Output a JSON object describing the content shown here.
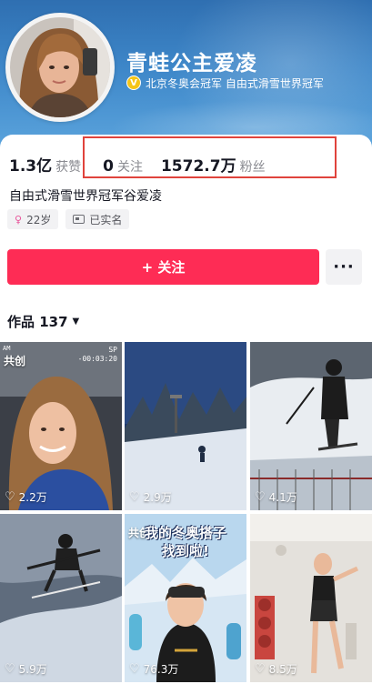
{
  "profile": {
    "name": "青蛙公主爱凌",
    "verification": "北京冬奥会冠军 自由式滑雪世界冠军",
    "bio": "自由式滑雪世界冠军谷爱凌"
  },
  "stats": {
    "likes_value": "1.3亿",
    "likes_label": "获赞",
    "following_value": "0",
    "following_label": "关注",
    "followers_value": "1572.7万",
    "followers_label": "粉丝"
  },
  "tags": {
    "age": "22岁",
    "realname": "已实名"
  },
  "actions": {
    "follow_label": "+ 关注",
    "more_label": "···"
  },
  "works": {
    "label": "作品 137"
  },
  "videos": [
    {
      "likes": "2.2万",
      "badge": "共创",
      "cam_top_left": "AM",
      "cam_sp": "SP",
      "cam_time": "-00:03:20"
    },
    {
      "likes": "2.9万"
    },
    {
      "likes": "4.1万"
    },
    {
      "likes": "5.9万"
    },
    {
      "likes": "76.3万",
      "badge": "共创",
      "poster_line1": "我的冬奥搭子",
      "poster_line2": "找到啦!"
    },
    {
      "likes": "8.5万"
    }
  ],
  "colors": {
    "accent": "#fe2c55",
    "highlight_box": "#e0433c",
    "header_blue": "#3d86c8"
  },
  "icons": [
    "verified-badge-icon",
    "gender-female-icon",
    "id-card-icon",
    "heart-icon",
    "caret-down-icon",
    "more-dots-icon"
  ]
}
